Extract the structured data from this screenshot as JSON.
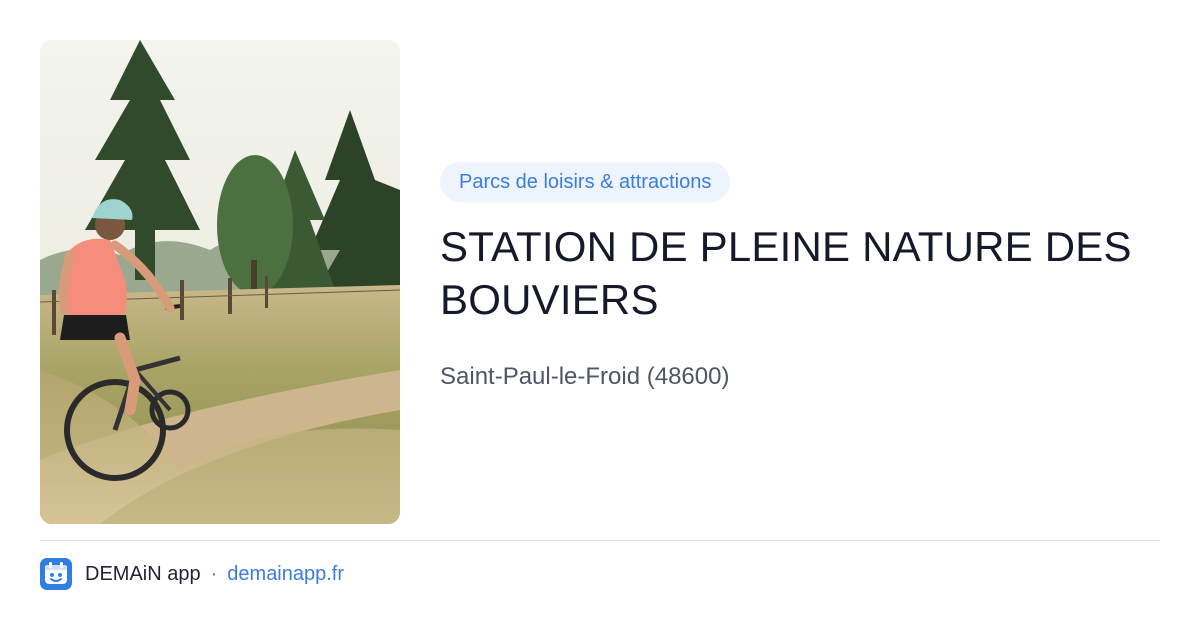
{
  "card": {
    "category": "Parcs de loisirs & attractions",
    "title": "STATION DE PLEINE NATURE DES BOUVIERS",
    "location": "Saint-Paul-le-Froid (48600)"
  },
  "footer": {
    "app_name": "DEMAiN app",
    "separator": "·",
    "url": "demainapp.fr"
  },
  "icons": {
    "app_logo": "demain-app-logo-icon"
  },
  "colors": {
    "accent": "#3b7ddd",
    "pill_background": "#eef4fd",
    "title": "#151a2b",
    "subtitle": "#4f5665",
    "divider": "#dde1e7"
  }
}
